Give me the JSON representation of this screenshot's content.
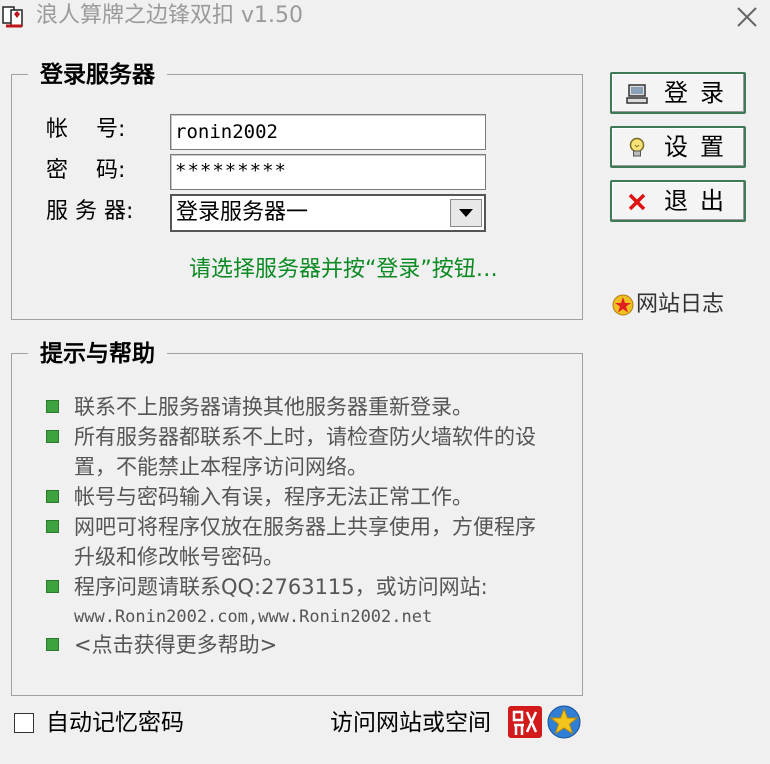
{
  "window": {
    "title": "浪人算牌之边锋双扣 v1.50",
    "icon": "card-game-app-icon",
    "close_icon": "close-icon"
  },
  "login_group": {
    "legend": "登录服务器",
    "account_label": "帐    号:",
    "account_value": "ronin2002",
    "password_label": "密    码:",
    "password_value": "*********",
    "server_label": "服 务 器:",
    "server_selected": "登录服务器一",
    "hint": "请选择服务器并按“登录”按钮…"
  },
  "side_buttons": {
    "login_label": "登录",
    "login_icon": "computer-icon",
    "settings_label": "设置",
    "settings_icon": "lightbulb-icon",
    "exit_label": "退出",
    "exit_icon": "red-x-icon",
    "site_log_label": "网站日志",
    "site_log_icon": "star-badge-icon"
  },
  "help_group": {
    "legend": "提示与帮助",
    "items": [
      "联系不上服务器请换其他服务器重新登录。",
      "所有服务器都联系不上时，请检查防火墙软件的设置，不能禁止本程序访问网络。",
      "帐号与密码输入有误，程序无法正常工作。",
      "网吧可将程序仅放在服务器上共享使用，方便程序升级和修改帐号密码。",
      "程序问题请联系QQ:2763115，或访问网站:",
      "<点击获得更多帮助>"
    ],
    "websites": "www.Ronin2002.com,www.Ronin2002.net"
  },
  "footer": {
    "remember_label": "自动记忆密码",
    "remember_checked": false,
    "visit_label": "访问网站或空间",
    "seal_icon": "red-seal-icon",
    "logo_icon": "star-logo-icon"
  },
  "colors": {
    "hint_green": "#0c8a23",
    "bullet_green": "#3ea33e",
    "button_border": "#3e7a57",
    "background": "#f0f0f0"
  }
}
